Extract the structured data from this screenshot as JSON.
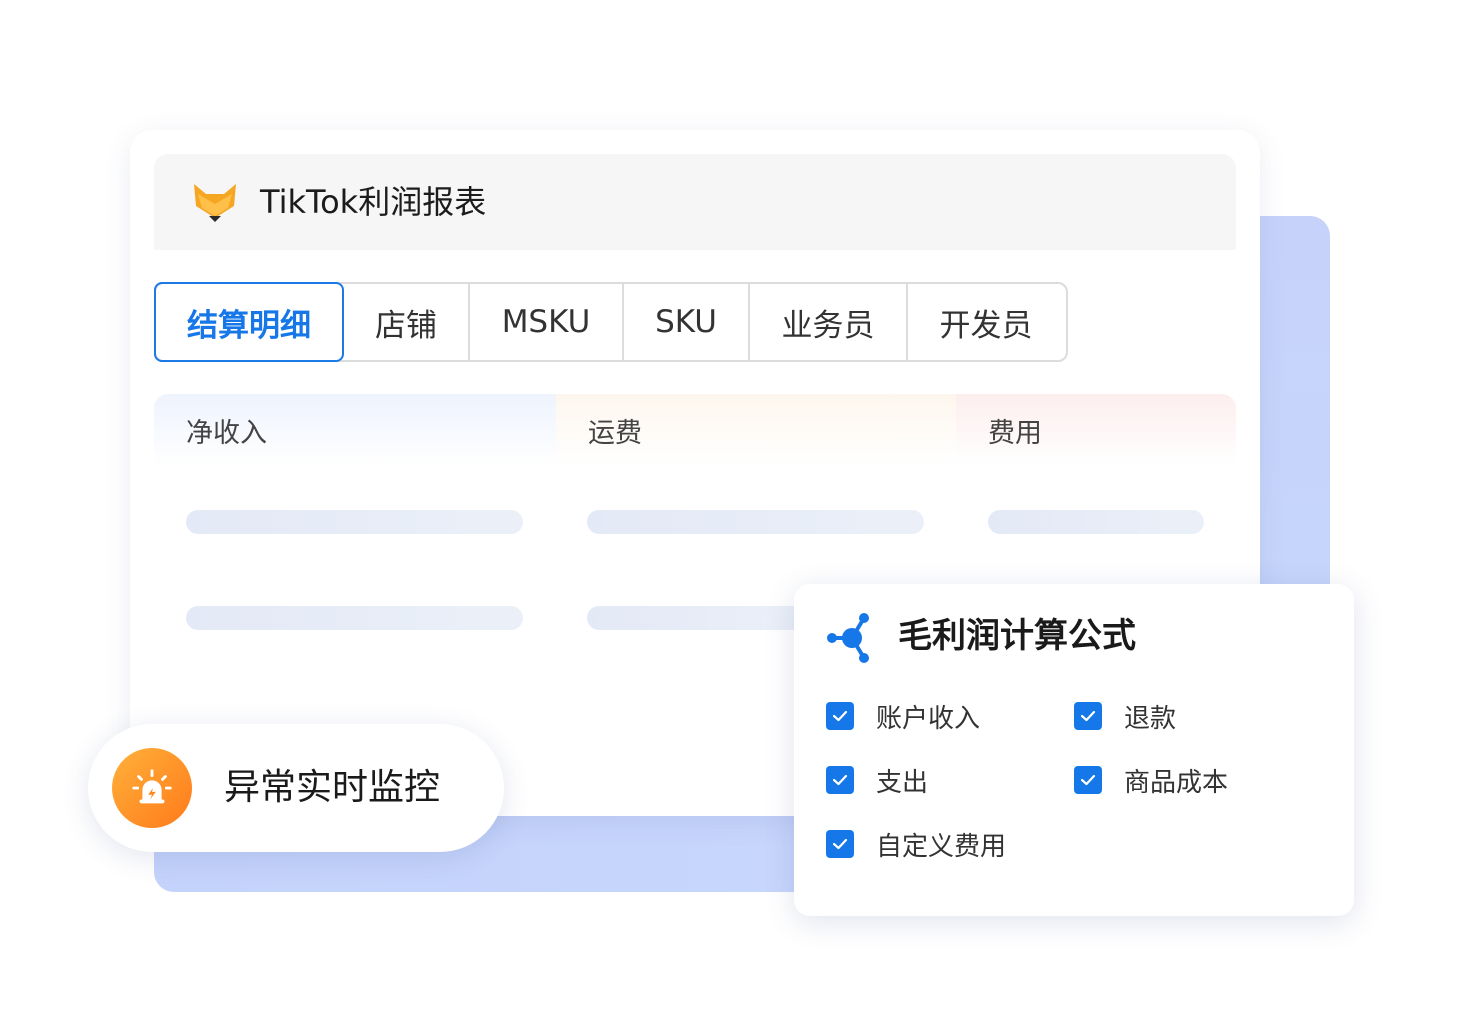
{
  "header": {
    "title": "TikTok利润报表"
  },
  "tabs": [
    {
      "label": "结算明细",
      "active": true
    },
    {
      "label": "店铺",
      "active": false
    },
    {
      "label": "MSKU",
      "active": false
    },
    {
      "label": "SKU",
      "active": false
    },
    {
      "label": "业务员",
      "active": false
    },
    {
      "label": "开发员",
      "active": false
    }
  ],
  "columns": [
    {
      "label": "净收入"
    },
    {
      "label": "运费"
    },
    {
      "label": "费用"
    }
  ],
  "formula": {
    "title": "毛利润计算公式",
    "items": [
      {
        "label": "账户收入",
        "checked": true
      },
      {
        "label": "退款",
        "checked": true
      },
      {
        "label": "支出",
        "checked": true
      },
      {
        "label": "商品成本",
        "checked": true
      },
      {
        "label": "自定义费用",
        "checked": true
      }
    ]
  },
  "monitor": {
    "label": "异常实时监控"
  },
  "colors": {
    "accent": "#1677e8",
    "logo_orange": "#f5a623",
    "monitor_orange": "#ff8a1f",
    "back_panel": "#c6d4fb"
  },
  "icons": {
    "logo": "fox-logo-icon",
    "formula": "network-node-icon",
    "monitor": "alarm-siren-icon",
    "check": "checkmark-icon"
  }
}
